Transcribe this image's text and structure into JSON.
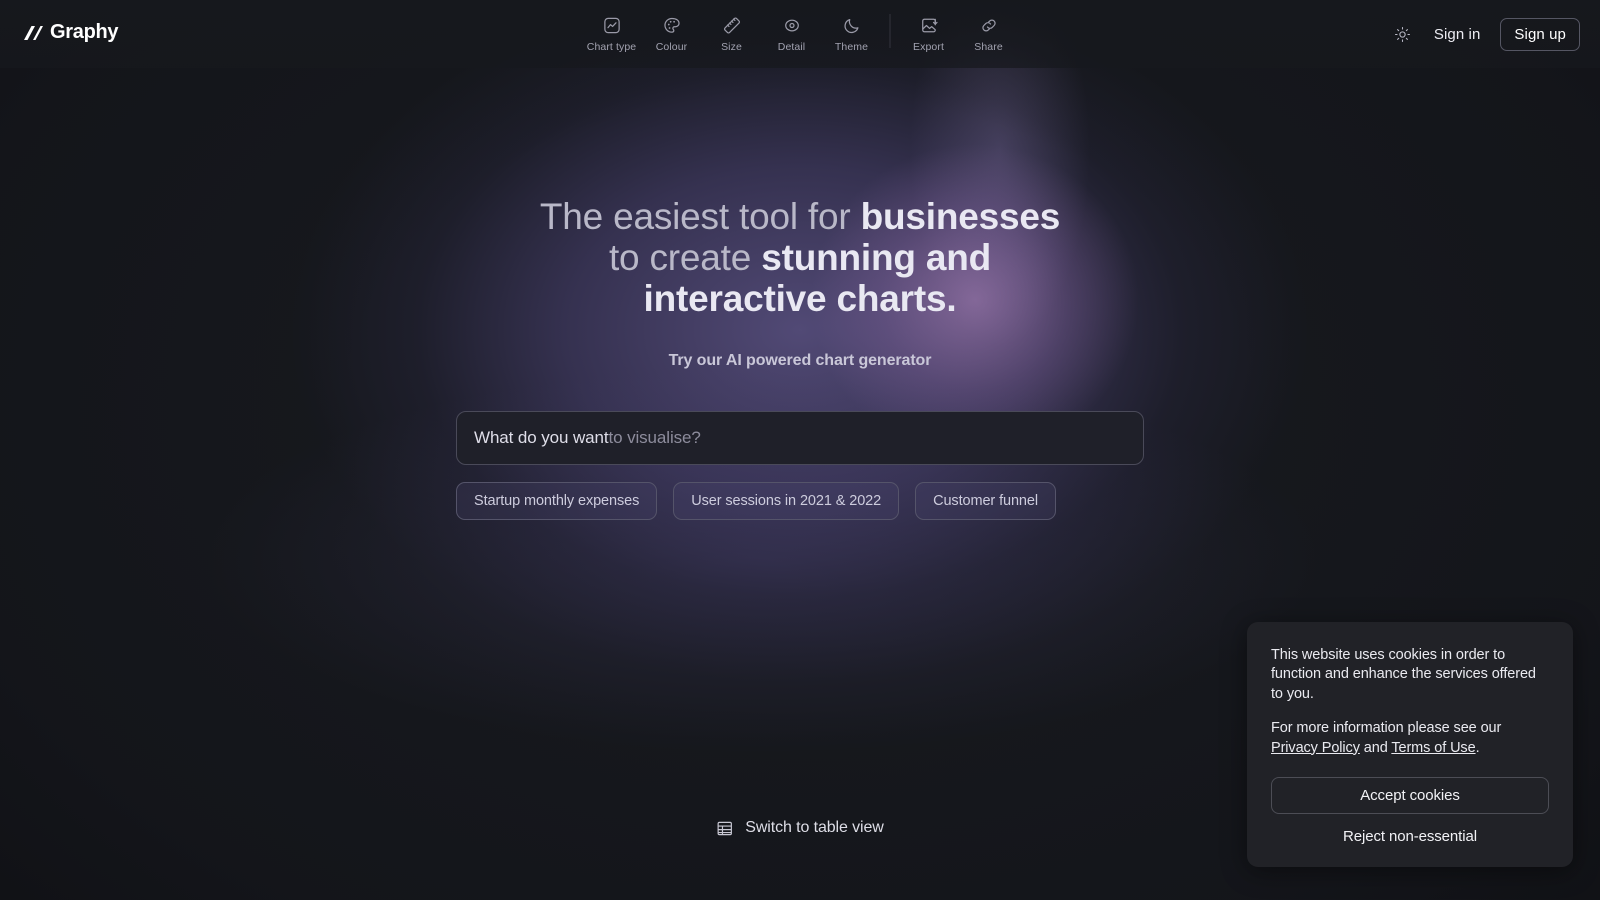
{
  "brand": {
    "name": "Graphy",
    "logo_icon": "graphy-slash-mark"
  },
  "toolbar": {
    "items": [
      {
        "label": "Chart type",
        "icon": "chart-type-icon"
      },
      {
        "label": "Colour",
        "icon": "palette-icon"
      },
      {
        "label": "Size",
        "icon": "ruler-icon"
      },
      {
        "label": "Detail",
        "icon": "target-icon"
      },
      {
        "label": "Theme",
        "icon": "moon-icon"
      },
      {
        "label": "Export",
        "icon": "export-image-icon"
      },
      {
        "label": "Share",
        "icon": "link-icon"
      }
    ]
  },
  "account": {
    "theme_toggle_icon": "sun-icon",
    "sign_in": "Sign in",
    "sign_up": "Sign up"
  },
  "hero": {
    "headline_line1_normal": "The easiest tool for ",
    "headline_line1_strong": "businesses",
    "headline_line2_normal": "to create ",
    "headline_line2_strong": "stunning and",
    "headline_line3_strong": "interactive charts.",
    "subheadline": "Try our AI powered chart generator"
  },
  "prompt": {
    "typed_text": "What do you want ",
    "ghost_text": "to visualise?",
    "placeholder": "What do you want to visualise?",
    "value": ""
  },
  "suggestions": [
    {
      "label": "Startup monthly expenses"
    },
    {
      "label": "User sessions in 2021 & 2022"
    },
    {
      "label": "Customer funnel"
    }
  ],
  "table_switch": {
    "label": "Switch to table view",
    "icon": "table-icon"
  },
  "cookie_banner": {
    "paragraph_1": "This website uses cookies in order to function and enhance the services offered to you.",
    "paragraph_2_prefix": "For more information please see our ",
    "privacy_link": "Privacy Policy",
    "paragraph_2_middle": " and ",
    "terms_link": "Terms of Use",
    "paragraph_2_suffix": ".",
    "accept_label": "Accept cookies",
    "reject_label": "Reject non-essential"
  },
  "colors": {
    "background": "#16181d",
    "glow_purple": "#7668ac",
    "glow_pink": "#ba8cc8",
    "panel": "#212227",
    "input_bg": "#1f2029",
    "text_primary": "#e9e8f2",
    "text_muted": "#a2a2b0"
  }
}
